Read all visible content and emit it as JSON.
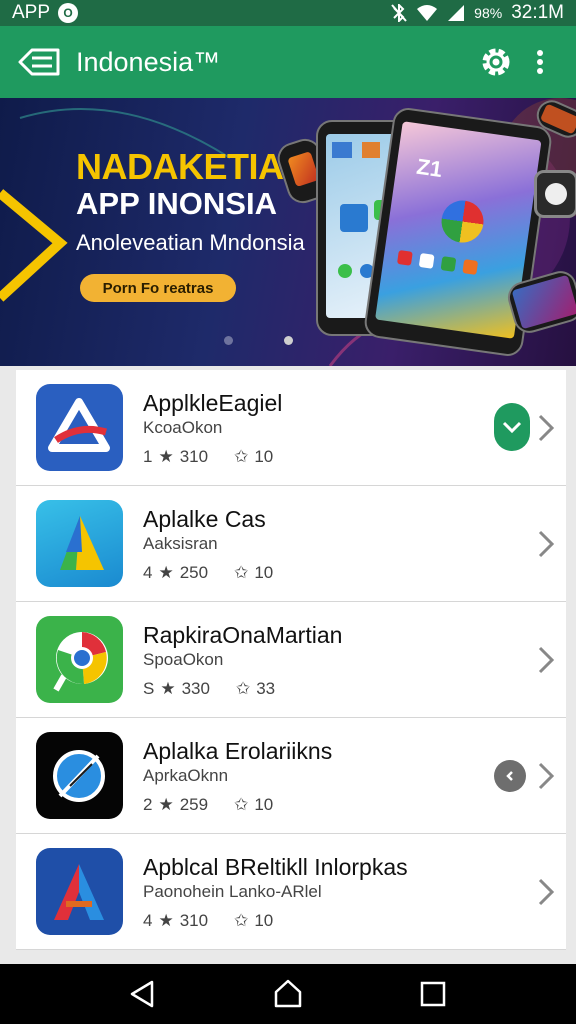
{
  "status_bar": {
    "left_text": "APP",
    "badge_text": "O",
    "battery_text": "98%",
    "time": "32:1M",
    "icons": [
      "bluetooth-off-icon",
      "wifi-icon",
      "signal-icon"
    ]
  },
  "app_bar": {
    "title": "Indonesia™",
    "icons": [
      "back-menu-icon",
      "settings-icon",
      "more-vert-icon"
    ]
  },
  "banner": {
    "headline1": "NADAKETIA",
    "headline2": "APP INONSIA",
    "subtitle": "Anoleveatian Mndonsia",
    "cta_label": "Porn Fo reatras",
    "active_dot": 1
  },
  "apps": [
    {
      "name": "ApplkleEagiel",
      "subtitle": "KcoaOkon",
      "rating": "1",
      "reviews": "310",
      "downloads": "10",
      "icon": "delta-app-icon",
      "action": "download-pill"
    },
    {
      "name": "Aplalke Cas",
      "subtitle": "Aaksisran",
      "rating": "4",
      "reviews": "250",
      "downloads": "10",
      "icon": "triangle-app-icon",
      "action": "none"
    },
    {
      "name": "RapkiraOnaMartian",
      "subtitle": "SpoaOkon",
      "rating": "S",
      "reviews": "330",
      "downloads": "33",
      "icon": "chrome-like-app-icon",
      "action": "none"
    },
    {
      "name": "Aplalka Erolariikns",
      "subtitle": "AprkaOknn",
      "rating": "2",
      "reviews": "259",
      "downloads": "10",
      "icon": "compass-app-icon",
      "action": "grey-circle"
    },
    {
      "name": "Apblcal BReltikll Inlorpkas",
      "subtitle": "Paonohein Lanko-ARlel",
      "rating": "4",
      "reviews": "310",
      "downloads": "10",
      "icon": "letter-a-app-icon",
      "action": "none"
    }
  ],
  "nav_bar": {
    "icons": [
      "nav-back-icon",
      "nav-home-icon",
      "nav-recents-icon"
    ]
  },
  "colors": {
    "status_bar": "#1f6b45",
    "app_bar": "#1f9a5f",
    "accent_yellow": "#f5c400",
    "cta": "#f2b233"
  }
}
